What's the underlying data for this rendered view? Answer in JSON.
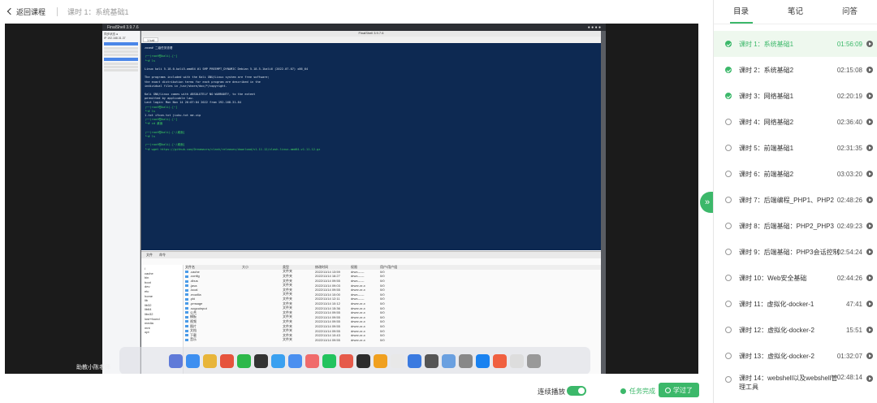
{
  "header": {
    "back_label": "返回课程",
    "lesson_title": "课时 1：系统基础1"
  },
  "video": {
    "caption": "助教小陈老师",
    "terminal_app": "FinalShell 3.9.7.6",
    "terminal_tab": "1 kali",
    "terminal_lines": [
      "zoom# 二级任务查看",
      "",
      "┌──(root㉿kali)-[~]",
      "└─# ls",
      "",
      "Linux kali 5.18.0-kali5-amd64 #1 SMP PREEMPT_DYNAMIC Debian 5.18.5-1kali6 (2022-07-07) x86_64",
      "",
      "The programs included with the Kali GNU/Linux system are free software;",
      "the exact distribution terms for each program are described in the",
      "individual files in /usr/share/doc/*/copyright.",
      "",
      "Kali GNU/Linux comes with ABSOLUTELY NO WARRANTY, to the extent",
      "permitted by applicable law.",
      "Last login: Mon Nov 14 20:07:04 2022 from 192.168.31.84",
      "┌──(root㉿kali)-[~]",
      "└─# ls",
      "1.txt  ifcon.txt  jiuku.txt  me.zip",
      "┌──(root㉿kali)-[~]",
      "└─# cd 桌面",
      "",
      "┌──(root㉿kali)-[~/桌面]",
      "└─# ls",
      "",
      "┌──(root㉿kali)-[~/桌面]",
      "└─# wget https://github.com/Dreamacro/clash/releases/download/v1.11.12/clash-linux-amd64-v1.11.12.gz"
    ],
    "file_tree": [
      "/",
      "cache",
      "bin",
      "boot",
      "dev",
      "etc",
      "home",
      "lib",
      "lib32",
      "lib64",
      "libx32",
      "lost+found",
      "media",
      "mnt",
      "opt"
    ],
    "file_headers": [
      "文件名",
      "大小",
      "类型",
      "修改时间",
      "权限",
      "用户/用户组"
    ],
    "files": [
      [
        ".cache",
        "",
        "文件夹",
        "2022/11/14 13:59",
        "drwx------",
        "0/0"
      ],
      [
        ".config",
        "",
        "文件夹",
        "2022/11/14 16:27",
        "drwx------",
        "0/0"
      ],
      [
        ".dbus",
        "",
        "文件夹",
        "2022/11/14 09:55",
        "drwx------",
        "0/0"
      ],
      [
        ".java",
        "",
        "文件夹",
        "2022/11/14 09:03",
        "drwxr-xr-x",
        "0/0"
      ],
      [
        ".local",
        "",
        "文件夹",
        "2022/11/14 09:55",
        "drwxr-xr-x",
        "0/0"
      ],
      [
        ".mozilla",
        "",
        "文件夹",
        "2022/11/14 10:00",
        "drwx------",
        "0/0"
      ],
      [
        ".pki",
        "",
        "文件夹",
        "2022/11/14 12:11",
        "drwx------",
        "0/0"
      ],
      [
        ".pmsage",
        "",
        "文件夹",
        "2022/11/14 10:12",
        "drwxr-xr-x",
        "0/0"
      ],
      [
        ".sogouinput",
        "",
        "文件夹",
        "2022/11/14 15:36",
        "drwxr-xr-x",
        "0/0"
      ],
      [
        "公共",
        "",
        "文件夹",
        "2022/11/14 09:55",
        "drwxr-xr-x",
        "0/0"
      ],
      [
        "模板",
        "",
        "文件夹",
        "2022/11/14 09:55",
        "drwxr-xr-x",
        "0/0"
      ],
      [
        "视频",
        "",
        "文件夹",
        "2022/11/14 09:55",
        "drwxr-xr-x",
        "0/0"
      ],
      [
        "图片",
        "",
        "文件夹",
        "2022/11/14 09:55",
        "drwxr-xr-x",
        "0/0"
      ],
      [
        "文档",
        "",
        "文件夹",
        "2022/11/14 09:55",
        "drwxr-xr-x",
        "0/0"
      ],
      [
        "下载",
        "",
        "文件夹",
        "2022/11/14 10:43",
        "drwxr-xr-x",
        "0/0"
      ],
      [
        "音乐",
        "",
        "文件夹",
        "2022/11/14 09:55",
        "drwxr-xr-x",
        "0/0"
      ]
    ],
    "dock_colors": [
      "#5f7ad8",
      "#3d8ff0",
      "#e8b53a",
      "#e6533c",
      "#2db84a",
      "#333333",
      "#3aa0f0",
      "#4a8ff0",
      "#f06b6b",
      "#22c35e",
      "#e65a4a",
      "#2c2c2c",
      "#f0a020",
      "#e8e8e8",
      "#3a7ae0",
      "#555555",
      "#6aa0e0",
      "#888888",
      "#1a82f0",
      "#f06040",
      "#dddddd",
      "#999999"
    ]
  },
  "footer": {
    "autoplay_label": "连续播放",
    "task_label": "任务完成",
    "learned_label": "学过了"
  },
  "sidebar": {
    "tabs": [
      "目录",
      "笔记",
      "问答"
    ],
    "lessons": [
      {
        "title": "课时 1：系统基础1",
        "duration": "01:56:09",
        "status": "done",
        "current": true
      },
      {
        "title": "课时 2：系统基础2",
        "duration": "02:15:08",
        "status": "done",
        "current": false
      },
      {
        "title": "课时 3：网络基础1",
        "duration": "02:20:19",
        "status": "done",
        "current": false
      },
      {
        "title": "课时 4：网络基础2",
        "duration": "02:36:40",
        "status": "todo",
        "current": false
      },
      {
        "title": "课时 5：前端基础1",
        "duration": "02:31:35",
        "status": "todo",
        "current": false
      },
      {
        "title": "课时 6：前端基础2",
        "duration": "03:03:20",
        "status": "todo",
        "current": false
      },
      {
        "title": "课时 7：后端编程_PHP1、PHP2",
        "duration": "02:48:26",
        "status": "todo",
        "current": false
      },
      {
        "title": "课时 8：后端基础：PHP2_PHP3",
        "duration": "02:49:23",
        "status": "todo",
        "current": false
      },
      {
        "title": "课时 9：后端基础：PHP3会话控制",
        "duration": "02:54:24",
        "status": "todo",
        "current": false
      },
      {
        "title": "课时 10：Web安全基础",
        "duration": "02:44:26",
        "status": "todo",
        "current": false
      },
      {
        "title": "课时 11：虚拟化-docker-1",
        "duration": "47:41",
        "status": "todo",
        "current": false
      },
      {
        "title": "课时 12：虚拟化-docker-2",
        "duration": "15:51",
        "status": "todo",
        "current": false
      },
      {
        "title": "课时 13：虚拟化-docker-2",
        "duration": "01:32:07",
        "status": "todo",
        "current": false
      },
      {
        "title": "课时 14：webshell以及webshell管理工具",
        "duration": "02:48:14",
        "status": "todo",
        "current": false
      }
    ]
  }
}
